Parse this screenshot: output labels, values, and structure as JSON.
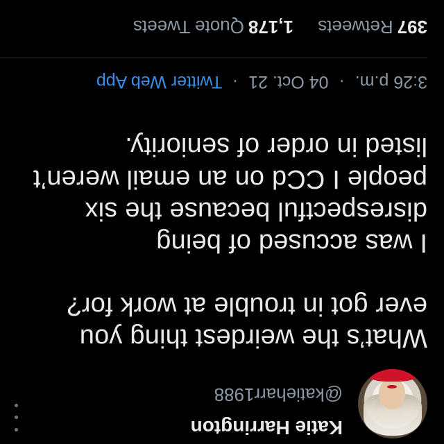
{
  "author": {
    "name": "Katie Harrington",
    "handle": "@katieharr1988"
  },
  "tweet": {
    "question": "What’s the weirdest thing you\never got in trouble at work for?",
    "answer": "I was accused of being\ndisrespectful because the six\npeople I CCd on an email weren’t\nlisted in order of seniority."
  },
  "meta": {
    "time": "3:26 p.m.",
    "date": "04 Oct. 21",
    "separator": "·",
    "source": "Twitter Web App"
  },
  "stats": {
    "retweets_count": "397",
    "retweets_label": "Retweets",
    "quotes_count": "1,178",
    "quotes_label": "Quote Tweets"
  },
  "icons": {
    "more": "more-vertical-icon"
  },
  "colors": {
    "background": "#000000",
    "text": "#e7e9ea",
    "muted": "#8b98a5",
    "link": "#3b8ee8"
  }
}
